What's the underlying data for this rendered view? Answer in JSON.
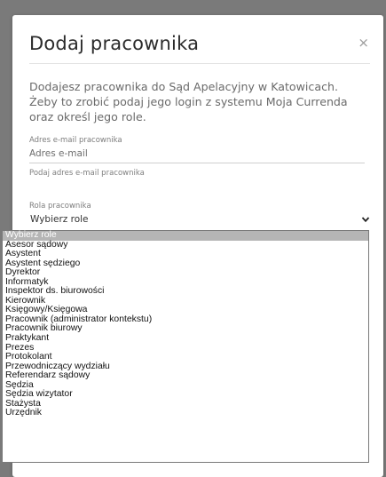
{
  "modal": {
    "title": "Dodaj pracownika",
    "close_symbol": "×",
    "intro": "Dodajesz pracownika do Sąd Apelacyjny w Katowicach. Żeby to zrobić podaj jego login z systemu Moja Currenda oraz określ jego role."
  },
  "email": {
    "label": "Adres e-mail pracownika",
    "placeholder": "Adres e-mail",
    "help": "Podaj adres e-mail pracownika"
  },
  "role": {
    "label": "Rola pracownika",
    "selected": "Wybierz role",
    "options": [
      "Wybierz role",
      "Asesor sądowy",
      "Asystent",
      "Asystent sędziego",
      "Dyrektor",
      "Informatyk",
      "Inspektor ds. biurowości",
      "Kierownik",
      "Księgowy/Księgowa",
      "Pracownik (administrator kontekstu)",
      "Pracownik biurowy",
      "Praktykant",
      "Prezes",
      "Protokolant",
      "Przewodniczący wydziału",
      "Referendarz sądowy",
      "Sędzia",
      "Sędzia wizytator",
      "Stażysta",
      "Urzędnik"
    ]
  },
  "icons": {
    "close": "close-icon",
    "chevron": "chevron-down-icon"
  },
  "colors": {
    "overlay": "#7a7a7a",
    "selected_option": "#b5b5b5"
  }
}
